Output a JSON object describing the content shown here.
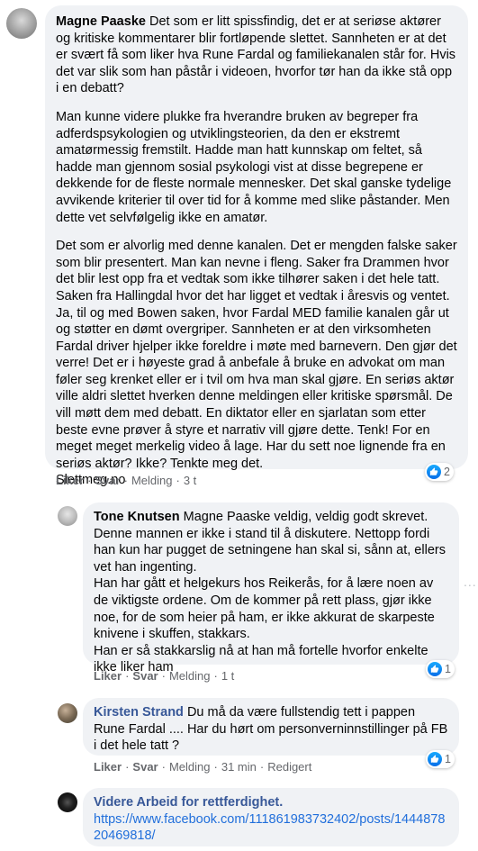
{
  "comment1": {
    "author": "Magne Paaske",
    "p1": "Det som er litt spissfindig, det er at seriøse aktører og kritiske kommentarer blir fortløpende slettet. Sannheten er at det er svært få som liker hva Rune Fardal og familiekanalen står for. Hvis det var slik som han påstår i videoen, hvorfor tør han da ikke stå opp i en debatt?",
    "p2": "Man kunne videre plukke fra hverandre bruken av begreper fra adferdspsykologien og utviklingsteorien, da den er ekstremt amatørmessig fremstilt. Hadde man hatt kunnskap om feltet, så hadde man gjennom sosial psykologi vist at disse begrepene er dekkende for de fleste normale mennesker. Det skal ganske tydelige avvikende kriterier til over tid for å komme med slike påstander. Men dette vet selvfølgelig ikke en amatør.",
    "p3": "Det som er alvorlig med denne kanalen. Det er mengden falske saker som blir presentert. Man kan nevne i fleng. Saker fra Drammen hvor det blir lest opp fra et vedtak som ikke tilhører saken i det hele tatt. Saken fra Hallingdal hvor det har ligget et vedtak i åresvis og ventet. Ja, til og med Bowen saken, hvor Fardal MED familie kanalen går ut og støtter en dømt overgriper. Sannheten er at den virksomheten Fardal driver hjelper ikke foreldre i møte med barnevern. Den gjør det verre! Det er i høyeste grad å anbefale å bruke en advokat om man føler seg krenket eller er i tvil om hva man skal gjøre. En seriøs aktør ville aldri slettet hverken denne meldingen eller kritiske spørsmål. De vill møtt dem med debatt. En diktator eller en sjarlatan som etter beste evne prøver å styre et narrativ vill gjøre dette. Tenk! For en meget meget merkelig video å lage. Har du sett noe lignende fra en seriøs aktør? Ikke? Tenkte meg det.",
    "p3_end": "Slettmeg.no",
    "like": "Liker",
    "reply": "Svar",
    "report": "Melding",
    "time": "3 t",
    "reactions": "2"
  },
  "comment2": {
    "author": "Tone Knutsen",
    "mention": "Magne Paaske",
    "text1": "veldig, veldig godt skrevet. Denne mannen er ikke i stand til å diskutere. Nettopp fordi han kun har pugget de setningene han skal si, sånn at, ellers vet han ingenting.",
    "text2": "Han har gått et helgekurs hos Reikerås, for å lære noen av de viktigste ordene. Om de kommer på rett plass, gjør ikke noe, for de som heier på ham, er ikke akkurat de skarpeste knivene i skuffen, stakkars.",
    "text3": "Han er så stakkarslig nå at han må fortelle hvorfor enkelte ikke liker ham",
    "like": "Liker",
    "reply": "Svar",
    "report": "Melding",
    "time": "1 t",
    "reactions": "1",
    "more": "..."
  },
  "comment3": {
    "author": "Kirsten Strand",
    "text": "Du må da være fullstendig tett i pappen Rune Fardal .... Har du hørt om personverninnstillinger på FB i det hele tatt ?",
    "like": "Liker",
    "reply": "Svar",
    "report": "Melding",
    "time": "31 min",
    "edited": "Redigert",
    "reactions": "1"
  },
  "comment4": {
    "author": "Videre Arbeid for rettferdighet.",
    "link": "https://www.facebook.com/111861983732402/posts/144487820469818/"
  },
  "colors": {
    "bubble": "#f0f2f5",
    "link": "#216fdb",
    "meta": "#65676b"
  }
}
